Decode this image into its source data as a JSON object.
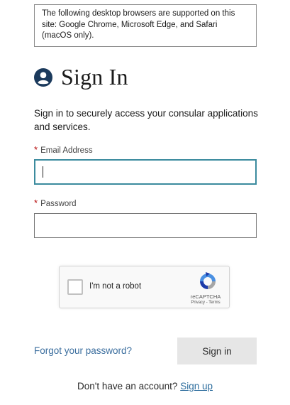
{
  "notice": {
    "text": "The following desktop browsers are supported on this site: Google Chrome, Microsoft Edge, and Safari (macOS only)."
  },
  "header": {
    "icon": "user-circle-icon",
    "title": "Sign In"
  },
  "intro": {
    "text": "Sign in to securely access your consular applications and services."
  },
  "form": {
    "required_marker": "*",
    "email": {
      "label": "Email Address",
      "value": ""
    },
    "password": {
      "label": "Password",
      "value": ""
    }
  },
  "captcha": {
    "label": "I'm not a robot",
    "brand": "reCAPTCHA",
    "links": "Privacy - Terms",
    "icon": "recaptcha-logo-icon"
  },
  "actions": {
    "forgot_label": "Forgot your password?",
    "signin_label": "Sign in"
  },
  "signup": {
    "prompt": "Don't have an account?",
    "link_label": "Sign up"
  },
  "colors": {
    "focus_border": "#3b8b9e",
    "link": "#3b6e9e",
    "required": "#b50909",
    "button_bg": "#e6e6e6"
  }
}
